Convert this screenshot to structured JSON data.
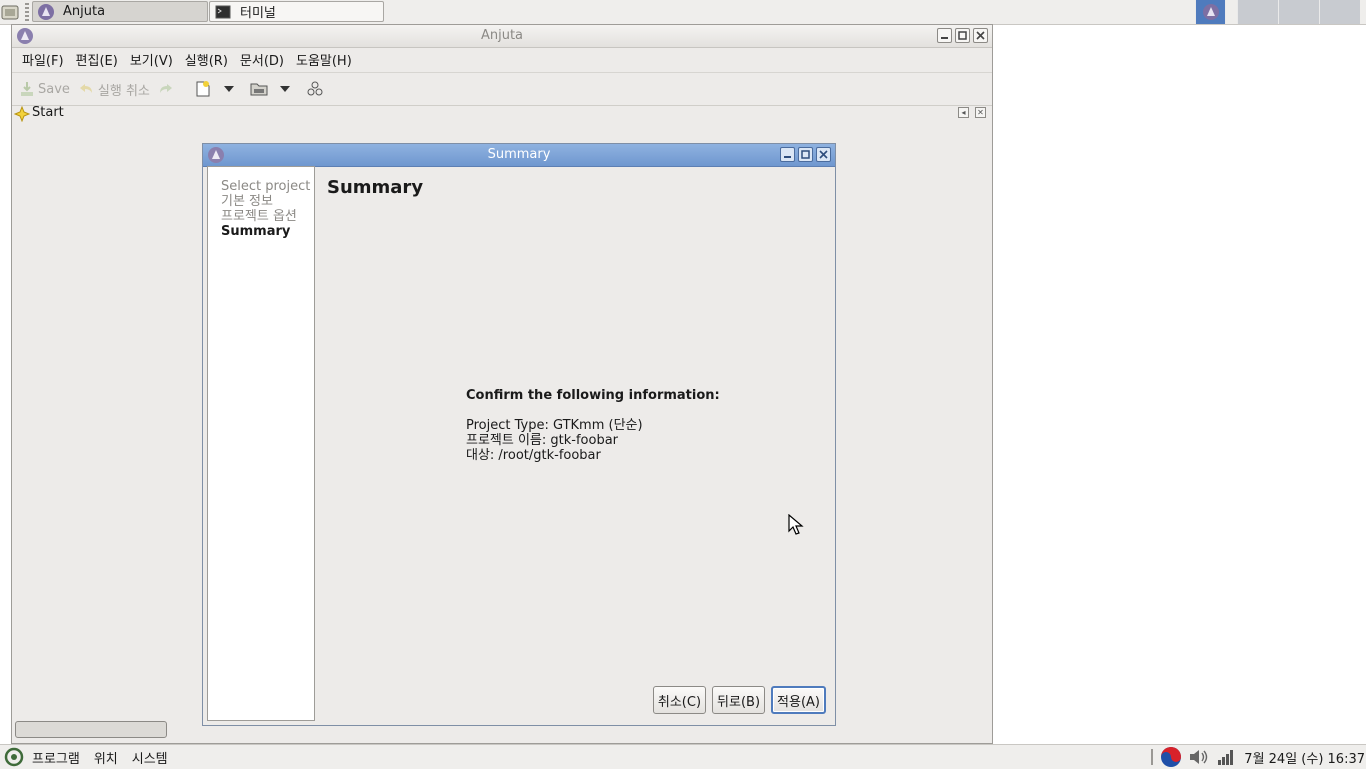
{
  "top_panel": {
    "tasks": [
      {
        "label": "Anjuta"
      },
      {
        "label": "터미널"
      }
    ]
  },
  "window": {
    "title": "Anjuta",
    "menus": [
      "파일(F)",
      "편집(E)",
      "보기(V)",
      "실행(R)",
      "문서(D)",
      "도움말(H)"
    ],
    "toolbar": {
      "save_label": "Save",
      "undo_label": "실행 취소"
    },
    "dock_title": "Start"
  },
  "dialog": {
    "title": "Summary",
    "steps": [
      "Select project",
      "기본 정보",
      "프로젝트 옵션",
      "Summary"
    ],
    "page_title": "Summary",
    "confirm_heading": "Confirm the following information:",
    "info_lines": [
      "Project Type: GTKmm (단순)",
      "프로젝트 이름: gtk-foobar",
      "대상: /root/gtk-foobar"
    ],
    "buttons": {
      "cancel": "취소(C)",
      "back": "뒤로(B)",
      "apply": "적용(A)"
    }
  },
  "bottom_panel": {
    "menus": [
      "프로그램",
      "위치",
      "시스템"
    ],
    "clock": "7월 24일 (수) 16:37"
  },
  "colors": {
    "accent": "#4f7bbd",
    "dialog_title": "#7aa0d6"
  }
}
